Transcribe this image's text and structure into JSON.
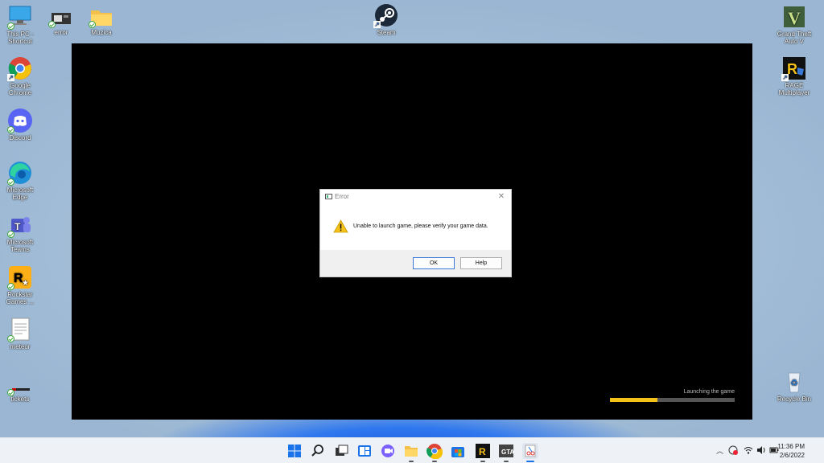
{
  "desktop": {
    "icons_left": [
      {
        "label": "This PC - Shortcut"
      },
      {
        "label": "Google Chrome"
      },
      {
        "label": "Discord"
      },
      {
        "label": "Microsoft Edge"
      },
      {
        "label": "Microsoft Teams"
      },
      {
        "label": "Rockstar Games ..."
      },
      {
        "label": "meteor"
      },
      {
        "label": "tickets"
      }
    ],
    "icons_top": [
      {
        "label": "error"
      },
      {
        "label": "Muzica"
      },
      {
        "label": "Steam"
      }
    ],
    "icons_right": [
      {
        "label": "Grand Theft Auto V"
      },
      {
        "label": "RAGE Multiplayer"
      },
      {
        "label": "Recycle Bin"
      }
    ]
  },
  "game": {
    "status_text": "Launching the game",
    "progress": 0.38,
    "progress_color": "#f2c21b"
  },
  "dialog": {
    "title": "Error",
    "message": "Unable to launch game, please verify your game data.",
    "ok_label": "OK",
    "help_label": "Help",
    "icon": "warning-icon"
  },
  "taskbar": {
    "apps": [
      "start-icon",
      "search-icon",
      "task-view-icon",
      "widgets-icon",
      "chat-icon",
      "file-explorer-icon",
      "chrome-icon",
      "store-icon",
      "rage-icon",
      "gta-icon",
      "snipping-tool-icon"
    ],
    "time": "11:36 PM",
    "date": "2/6/2022"
  }
}
